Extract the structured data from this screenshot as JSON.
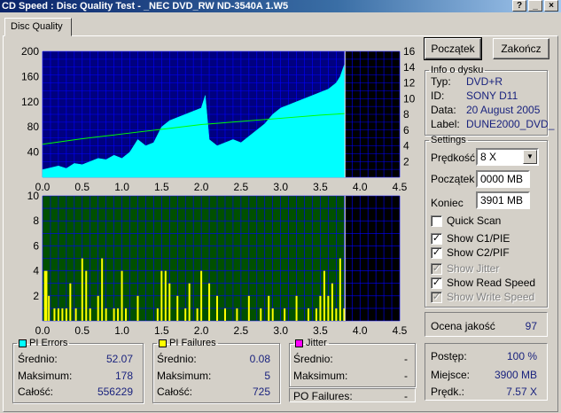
{
  "window": {
    "title": "CD Speed : Disc Quality Test - _NEC    DVD_RW ND-3540A  1.W5"
  },
  "tabs": [
    {
      "label": "Disc Quality"
    }
  ],
  "buttons": {
    "start": "Początek",
    "finish": "Zakończ"
  },
  "info": {
    "title": "Info o dysku",
    "rows": [
      {
        "label": "Typ:",
        "value": "DVD+R"
      },
      {
        "label": "ID:",
        "value": "SONY D11"
      },
      {
        "label": "Data:",
        "value": "20 August 2005"
      },
      {
        "label": "Label:",
        "value": "DUNE2000_DVD_"
      }
    ]
  },
  "settings": {
    "title": "Settings",
    "speed_label": "Prędkość",
    "speed_value": "8 X",
    "start_label": "Początek",
    "start_value": "0000 MB",
    "end_label": "Koniec",
    "end_value": "3901 MB",
    "checkboxes": [
      {
        "label": "Quick Scan",
        "checked": false,
        "enabled": true
      },
      {
        "label": "Show C1/PIE",
        "checked": true,
        "enabled": true
      },
      {
        "label": "Show C2/PIF",
        "checked": true,
        "enabled": true
      },
      {
        "label": "Show Jitter",
        "checked": true,
        "enabled": false
      },
      {
        "label": "Show Read Speed",
        "checked": true,
        "enabled": true
      },
      {
        "label": "Show Write Speed",
        "checked": true,
        "enabled": false
      }
    ]
  },
  "quality": {
    "label": "Ocena jakość",
    "value": "97"
  },
  "progress": {
    "rows": [
      {
        "label": "Postęp:",
        "value": "100 %"
      },
      {
        "label": "Miejsce:",
        "value": "3900 MB"
      },
      {
        "label": "Prędk.:",
        "value": "7.57 X"
      }
    ]
  },
  "stats": {
    "pi_errors": {
      "title": "PI Errors",
      "color": "#00ffff",
      "rows": [
        {
          "label": "Średnio:",
          "value": "52.07"
        },
        {
          "label": "Maksimum:",
          "value": "178"
        },
        {
          "label": "Całość:",
          "value": "556229"
        }
      ]
    },
    "pi_failures": {
      "title": "PI Failures",
      "color": "#ffff00",
      "rows": [
        {
          "label": "Średnio:",
          "value": "0.08"
        },
        {
          "label": "Maksimum:",
          "value": "5"
        },
        {
          "label": "Całość:",
          "value": "725"
        }
      ]
    },
    "jitter": {
      "title": "Jitter",
      "color": "#ff00ff",
      "rows": [
        {
          "label": "Średnio:",
          "value": "-"
        },
        {
          "label": "Maksimum:",
          "value": "-"
        }
      ],
      "po_label": "PO Failures:",
      "po_value": "-"
    }
  },
  "colors": {
    "top_plot_bg": "#000080",
    "bottom_plot_bg": "#005000",
    "grid": "#0000ff",
    "pie": "#00ffff",
    "pif": "#ffff00",
    "speed": "#00ff00"
  },
  "chart_data": [
    {
      "type": "area",
      "series": [
        {
          "name": "PI Errors",
          "x": [
            0.0,
            0.1,
            0.2,
            0.3,
            0.4,
            0.5,
            0.6,
            0.7,
            0.8,
            0.9,
            1.0,
            1.1,
            1.2,
            1.3,
            1.4,
            1.5,
            1.6,
            1.7,
            1.8,
            1.9,
            2.0,
            2.05,
            2.1,
            2.2,
            2.3,
            2.4,
            2.5,
            2.6,
            2.7,
            2.8,
            2.9,
            3.0,
            3.1,
            3.2,
            3.3,
            3.4,
            3.5,
            3.6,
            3.7,
            3.75,
            3.8,
            3.81
          ],
          "y": [
            12,
            15,
            18,
            14,
            22,
            20,
            25,
            30,
            28,
            35,
            30,
            40,
            60,
            50,
            55,
            80,
            90,
            95,
            100,
            105,
            110,
            130,
            60,
            50,
            55,
            60,
            55,
            65,
            75,
            85,
            100,
            110,
            115,
            120,
            125,
            130,
            135,
            140,
            150,
            160,
            178,
            0
          ]
        },
        {
          "name": "Read speed",
          "x": [
            0,
            0.5,
            1.0,
            1.5,
            2.0,
            2.5,
            3.0,
            3.5,
            3.81
          ],
          "y": [
            4.2,
            4.9,
            5.5,
            6.1,
            6.7,
            7.1,
            7.5,
            7.9,
            8.1
          ]
        }
      ],
      "x_ticks": [
        "0.0",
        "0.5",
        "1.0",
        "1.5",
        "2.0",
        "2.5",
        "3.0",
        "3.5",
        "4.0",
        "4.5"
      ],
      "y_ticks_left": [
        "40",
        "80",
        "120",
        "160",
        "200"
      ],
      "y_ticks_right": [
        "2",
        "4",
        "6",
        "8",
        "10",
        "12",
        "14",
        "16"
      ],
      "xlim": [
        0,
        4.5
      ],
      "ylim_left": [
        0,
        200
      ],
      "ylim_right": [
        0,
        16
      ]
    },
    {
      "type": "bar",
      "series": [
        {
          "name": "PI Failures",
          "x": [
            0.03,
            0.05,
            0.08,
            0.15,
            0.2,
            0.25,
            0.3,
            0.35,
            0.42,
            0.5,
            0.55,
            0.6,
            0.7,
            0.75,
            0.8,
            0.9,
            0.95,
            1.0,
            1.05,
            1.2,
            1.45,
            1.5,
            1.55,
            1.6,
            1.7,
            1.8,
            1.85,
            1.95,
            2.0,
            2.1,
            2.2,
            2.3,
            2.45,
            2.6,
            2.75,
            2.85,
            2.9,
            3.05,
            3.2,
            3.35,
            3.45,
            3.5,
            3.55,
            3.6,
            3.65,
            3.7,
            3.75,
            3.8
          ],
          "y": [
            4,
            4,
            2,
            1,
            1,
            1,
            1,
            3,
            1,
            5,
            4,
            1,
            2,
            5,
            1,
            1,
            1,
            4,
            1,
            2,
            1,
            4,
            4,
            3,
            2,
            1,
            3,
            1,
            4,
            3,
            2,
            1,
            1,
            2,
            1,
            2,
            1,
            1,
            2,
            1,
            1,
            2,
            4,
            2,
            3,
            1,
            5,
            1
          ]
        }
      ],
      "x_ticks": [
        "0.0",
        "0.5",
        "1.0",
        "1.5",
        "2.0",
        "2.5",
        "3.0",
        "3.5",
        "4.0",
        "4.5"
      ],
      "y_ticks_left": [
        "2",
        "4",
        "6",
        "8",
        "10"
      ],
      "xlim": [
        0,
        4.5
      ],
      "ylim": [
        0,
        10
      ]
    }
  ]
}
